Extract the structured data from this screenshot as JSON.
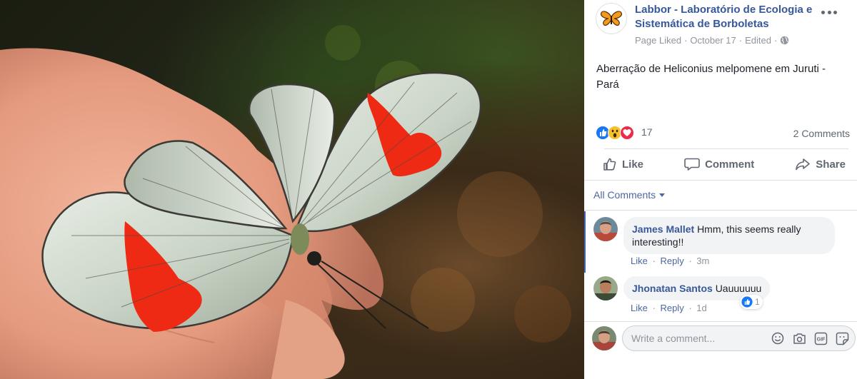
{
  "post": {
    "page_name": "Labbor - Laboratório de Ecologia e Sistemática de Borboletas",
    "meta": {
      "status": "Page Liked",
      "date": "October 17",
      "edited": "Edited",
      "privacy_icon": "globe-icon"
    },
    "text": "Aberração de Heliconius melpomene em Juruti - Pará",
    "photo": {
      "subject": "butterfly-on-hand"
    }
  },
  "reactions": {
    "icons": [
      "like-reaction-icon",
      "wow-reaction-icon",
      "love-reaction-icon"
    ],
    "count": "17",
    "comments_count": "2 Comments"
  },
  "actions": {
    "like": "Like",
    "comment": "Comment",
    "share": "Share"
  },
  "comments_filter": {
    "label": "All Comments"
  },
  "comments": [
    {
      "author": "James Mallet",
      "text": "Hmm, this seems really interesting!!",
      "like": "Like",
      "reply": "Reply",
      "time": "3m"
    },
    {
      "author": "Jhonatan Santos",
      "text": "Uauuuuuu",
      "like": "Like",
      "reply": "Reply",
      "time": "1d",
      "reaction_count": "1"
    }
  ],
  "composer": {
    "placeholder": "Write a comment...",
    "tools": [
      "emoji-icon",
      "camera-icon",
      "gif-icon",
      "sticker-icon"
    ]
  },
  "colors": {
    "link": "#365899",
    "meta": "#90949c",
    "accent": "#4267b2",
    "bubble": "#f2f3f5"
  }
}
